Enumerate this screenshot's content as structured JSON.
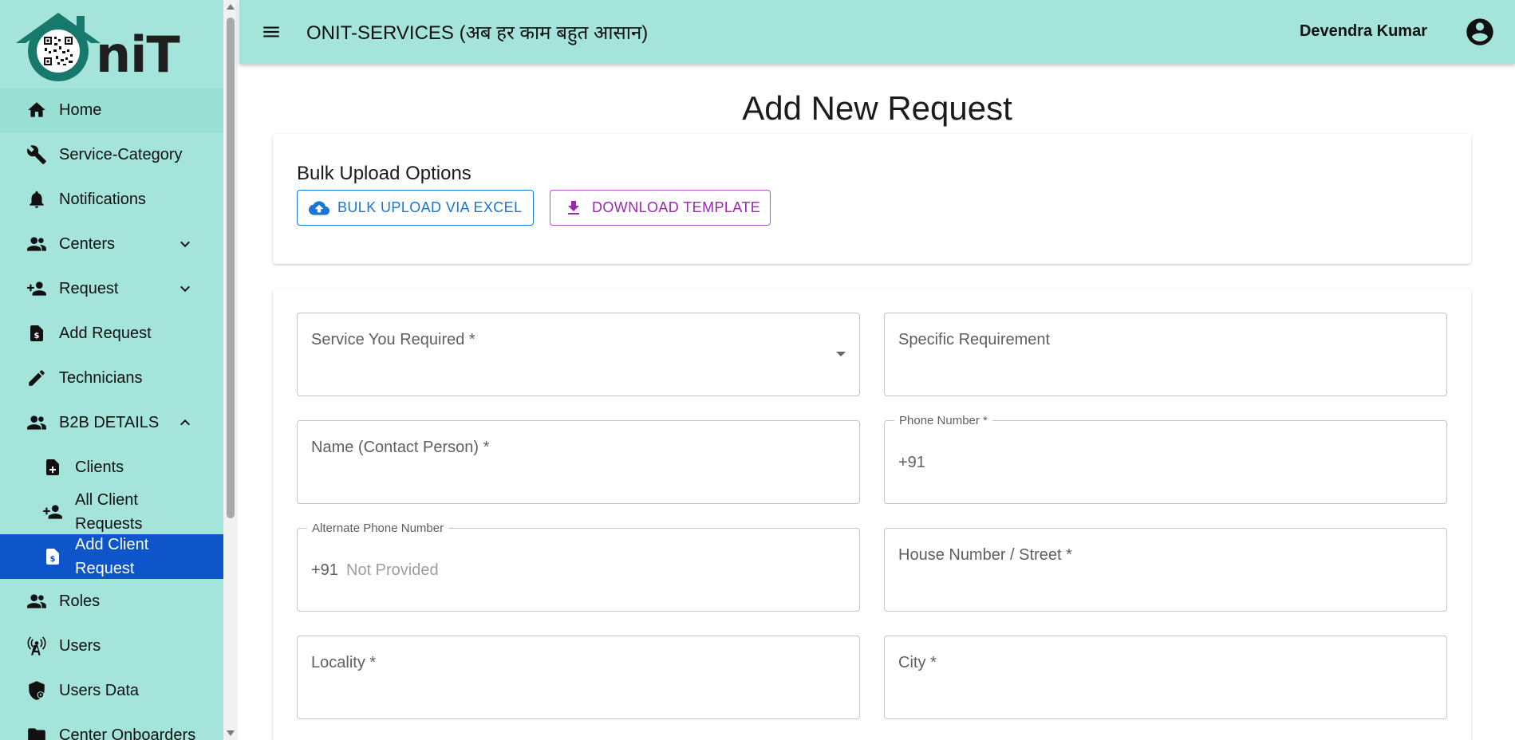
{
  "logo": {
    "text": "niT"
  },
  "sidebar": {
    "items": [
      {
        "label": "Home",
        "icon": "home-icon"
      },
      {
        "label": "Service-Category",
        "icon": "wrench-icon"
      },
      {
        "label": "Notifications",
        "icon": "bell-icon"
      },
      {
        "label": "Centers",
        "icon": "people-icon"
      },
      {
        "label": "Request",
        "icon": "person-add-icon"
      },
      {
        "label": "Add Request",
        "icon": "dollar-document-icon"
      },
      {
        "label": "Technicians",
        "icon": "pencil-icon"
      },
      {
        "label": "B2B DETAILS",
        "icon": "people-icon"
      }
    ],
    "sub_items": [
      {
        "label": "Clients",
        "icon": "document-plus-icon"
      },
      {
        "label": "All Client Requests",
        "icon": "person-add-icon"
      },
      {
        "label": "Add Client Request",
        "icon": "dollar-document-icon"
      }
    ],
    "bottom_items": [
      {
        "label": "Roles",
        "icon": "people-icon"
      },
      {
        "label": "Users",
        "icon": "antenna-icon"
      },
      {
        "label": "Users Data",
        "icon": "shield-icon"
      },
      {
        "label": "Center Onboarders",
        "icon": "folder-icon"
      }
    ]
  },
  "header": {
    "title": "ONIT-SERVICES (अब हर काम बहुत आसान)",
    "user_name": "Devendra Kumar"
  },
  "main": {
    "page_title": "Add New Request",
    "bulk": {
      "title": "Bulk Upload Options",
      "excel_label": "BULK UPLOAD VIA EXCEL",
      "template_label": "DOWNLOAD TEMPLATE"
    },
    "form": {
      "service_label": "Service You Required *",
      "specific_label": "Specific Requirement",
      "name_label": "Name (Contact Person) *",
      "phone_label": "Phone Number *",
      "phone_prefix": "+91",
      "alt_phone_label": "Alternate Phone Number",
      "alt_phone_prefix": "+91",
      "alt_phone_value": "Not Provided",
      "house_label": "House Number / Street *",
      "locality_label": "Locality *",
      "city_label": "City *"
    }
  },
  "colors": {
    "accent": "#a5e4da",
    "active_item": "#0d55c9",
    "primary_button": "#1976d2",
    "secondary_button": "#9c27b0"
  }
}
